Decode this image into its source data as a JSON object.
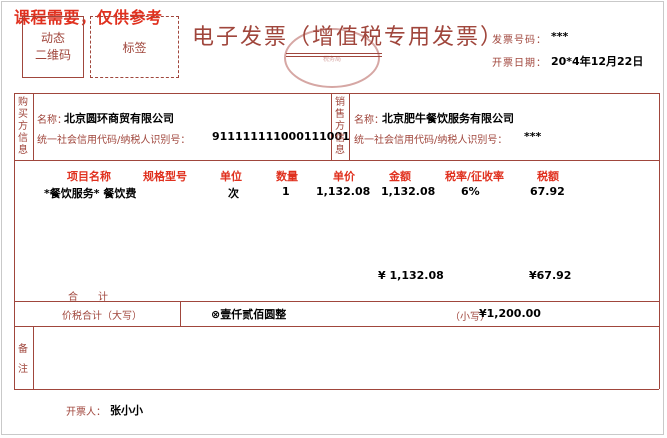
{
  "banner": "课程需要，仅供参考",
  "qr_text": [
    "动态",
    "二维码"
  ],
  "label_box": "标签",
  "title": "电子发票（增值税专用发票）",
  "stamp_text": "税务局",
  "header": {
    "invoice_no_label": "发票号码：",
    "invoice_no_value": "***",
    "date_label": "开票日期：",
    "date_value": "20*4年12月22日"
  },
  "buyer": {
    "side_label": [
      "购",
      "买",
      "方",
      "信",
      "息"
    ],
    "name_label": "名称：",
    "name_value": "北京圆环商贸有限公司",
    "id_label": "统一社会信用代码/纳税人识别号：",
    "id_value": "911111111000111001"
  },
  "seller": {
    "side_label": [
      "销",
      "售",
      "方",
      "信",
      "息"
    ],
    "name_label": "名称：",
    "name_value": "北京肥牛餐饮服务有限公司",
    "id_label": "统一社会信用代码/纳税人识别号：",
    "id_value": "***"
  },
  "table": {
    "headers": [
      "项目名称",
      "规格型号",
      "单位",
      "数量",
      "单价",
      "金额",
      "税率/征收率",
      "税额"
    ],
    "rows": [
      {
        "name": "*餐饮服务* 餐饮费",
        "spec": "",
        "unit": "次",
        "qty": "1",
        "price": "1,132.08",
        "amount": "1,132.08",
        "rate": "6%",
        "tax": "67.92"
      }
    ],
    "total_label": "合　　计",
    "total_amount": "¥ 1,132.08",
    "total_tax": "¥67.92"
  },
  "grand_total": {
    "label": "价税合计（大写）",
    "uppercase": "⊗壹仟贰佰圆整",
    "small_label": "（小写）",
    "small_value": "¥1,200.00"
  },
  "remark": {
    "side_label": [
      "备",
      "注"
    ]
  },
  "issuer": {
    "label": "开票人：",
    "value": "张小小"
  },
  "colors": {
    "line": "#a0463c",
    "banner": "#e0301e",
    "header_text": "#e0301e"
  }
}
